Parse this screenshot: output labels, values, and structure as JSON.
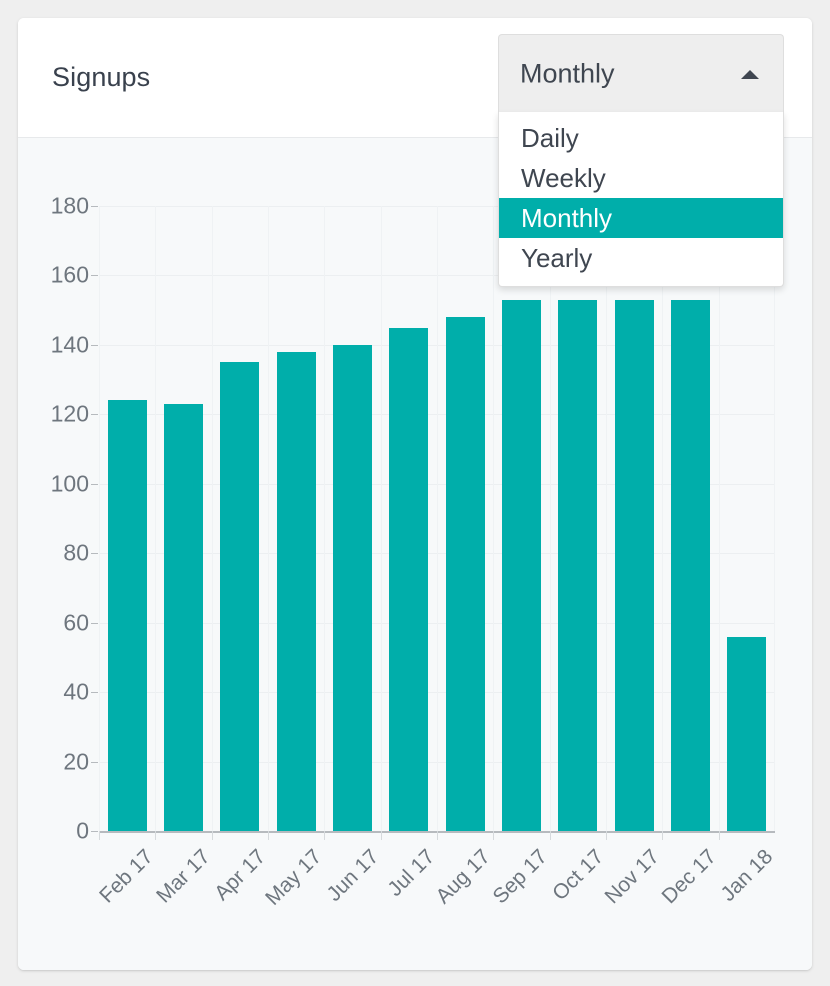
{
  "card": {
    "title": "Signups"
  },
  "dropdown": {
    "name": "period-selector",
    "selected": "Monthly",
    "caret_icon": "caret-up-icon",
    "options": [
      {
        "label": "Daily",
        "selected": false
      },
      {
        "label": "Weekly",
        "selected": false
      },
      {
        "label": "Monthly",
        "selected": true
      },
      {
        "label": "Yearly",
        "selected": false
      }
    ]
  },
  "colors": {
    "accent": "#00AEAA",
    "page_bg": "#EFEFEF",
    "card_bg": "#FFFFFF",
    "plot_bg": "#F7F9FA",
    "grid": "#ECEFF1",
    "axis": "#B6BABE",
    "tick_text": "#6E767E",
    "title_text": "#39414D",
    "dropdown_bg": "#EEEEEE"
  },
  "chart_data": {
    "type": "bar",
    "title": "Signups",
    "xlabel": "",
    "ylabel": "",
    "ylim": [
      0,
      180
    ],
    "yticks": [
      0,
      20,
      40,
      60,
      80,
      100,
      120,
      140,
      160,
      180
    ],
    "grid": true,
    "legend": false,
    "categories": [
      "Feb 17",
      "Mar 17",
      "Apr 17",
      "May 17",
      "Jun 17",
      "Jul 17",
      "Aug 17",
      "Sep 17",
      "Oct 17",
      "Nov 17",
      "Dec 17",
      "Jan 18"
    ],
    "values": [
      124,
      123,
      135,
      138,
      140,
      145,
      148,
      153,
      153,
      153,
      153,
      56
    ],
    "series": [
      {
        "name": "Signups",
        "color": "#00AEAA",
        "values": [
          124,
          123,
          135,
          138,
          140,
          145,
          148,
          153,
          153,
          153,
          153,
          56
        ]
      }
    ]
  }
}
